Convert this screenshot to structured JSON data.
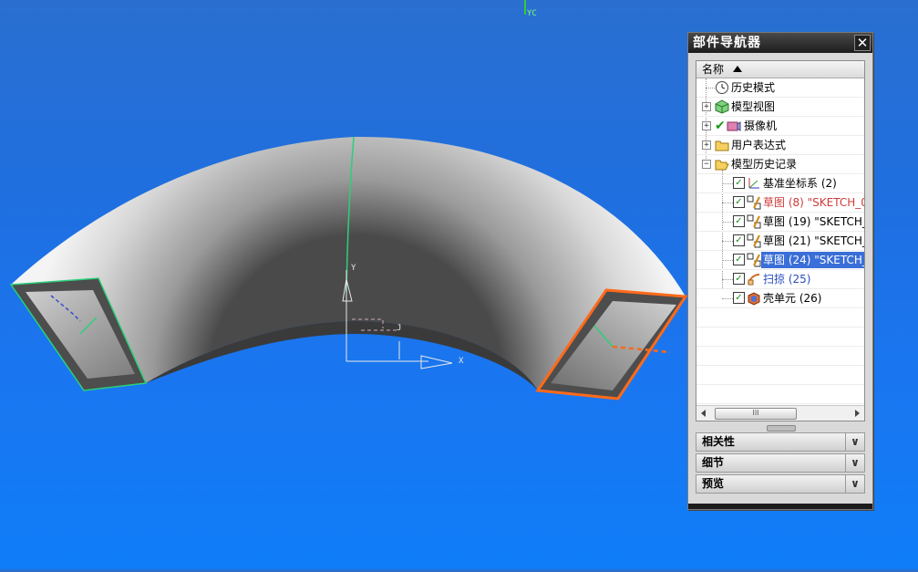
{
  "viewport": {
    "wcs_label": "YC",
    "axes": {
      "y": "Y",
      "x": "X",
      "j": "J"
    }
  },
  "navigator": {
    "title": "部件导航器",
    "close_glyph": "✕",
    "column_header": "名称",
    "rows": [
      {
        "label": "历史模式",
        "icon": "clock-icon"
      },
      {
        "label": "模型视图",
        "icon": "model-views-icon"
      },
      {
        "label": "摄像机",
        "icon": "camera-icon"
      },
      {
        "label": "用户表达式",
        "icon": "folder-icon"
      },
      {
        "label": "模型历史记录",
        "icon": "folder-open-icon"
      },
      {
        "label": "基准坐标系 (2)",
        "icon": "datum-csys-icon"
      },
      {
        "label": "草图 (8) \"SKETCH_0",
        "icon": "sketch-icon"
      },
      {
        "label": "草图 (19) \"SKETCH_",
        "icon": "sketch-icon"
      },
      {
        "label": "草图 (21) \"SKETCH_",
        "icon": "sketch-icon"
      },
      {
        "label": "草图 (24) \"SKETCH_",
        "icon": "sketch-icon"
      },
      {
        "label": "扫掠 (25)",
        "icon": "sweep-icon"
      },
      {
        "label": "壳单元 (26)",
        "icon": "shell-icon"
      }
    ],
    "scroll_thumb_grip": "III",
    "sections": [
      {
        "label": "相关性"
      },
      {
        "label": "细节"
      },
      {
        "label": "预览"
      }
    ],
    "colors": {
      "red_item": "#d23a3a",
      "blue_item": "#2a4db8",
      "selection": "#3a6ed8"
    }
  }
}
